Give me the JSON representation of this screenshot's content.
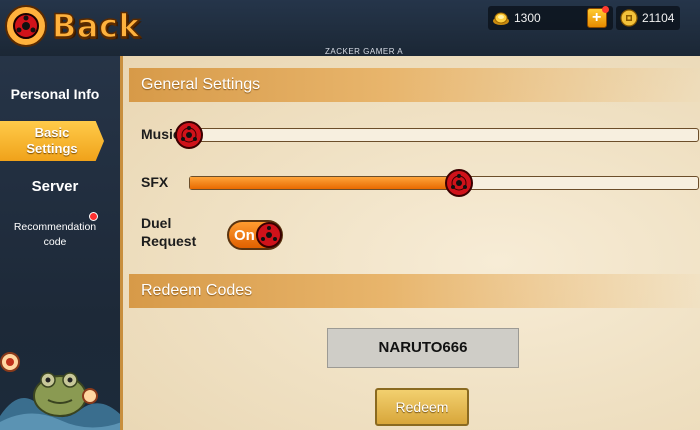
{
  "header": {
    "back_label": "Back",
    "watermark": "ZACKER GAMER A",
    "currency_primary": "1300",
    "currency_secondary": "21104"
  },
  "sidebar": {
    "items": [
      {
        "label": "Personal Info"
      },
      {
        "label_line1": "Basic",
        "label_line2": "Settings",
        "active": true
      },
      {
        "label": "Server"
      },
      {
        "label_line1": "Recommendation",
        "label_line2": "code"
      }
    ]
  },
  "general": {
    "title": "General Settings",
    "music_label": "Music",
    "music_level": 0.0,
    "sfx_label": "SFX",
    "sfx_level": 0.53,
    "duel_label_line1": "Duel",
    "duel_label_line2": "Request",
    "duel_state": "On"
  },
  "redeem": {
    "title": "Redeem Codes",
    "code_value": "NARUTO666",
    "button_label": "Redeem"
  },
  "colors": {
    "accent": "#f0a21a",
    "slider_fill": "#e86a00",
    "sharingan_red": "#d0121a"
  },
  "icons": [
    "sharingan-back-icon",
    "gold-ingot-icon",
    "plus-icon",
    "coin-icon",
    "sharingan-knob-icon",
    "frog-icon"
  ]
}
